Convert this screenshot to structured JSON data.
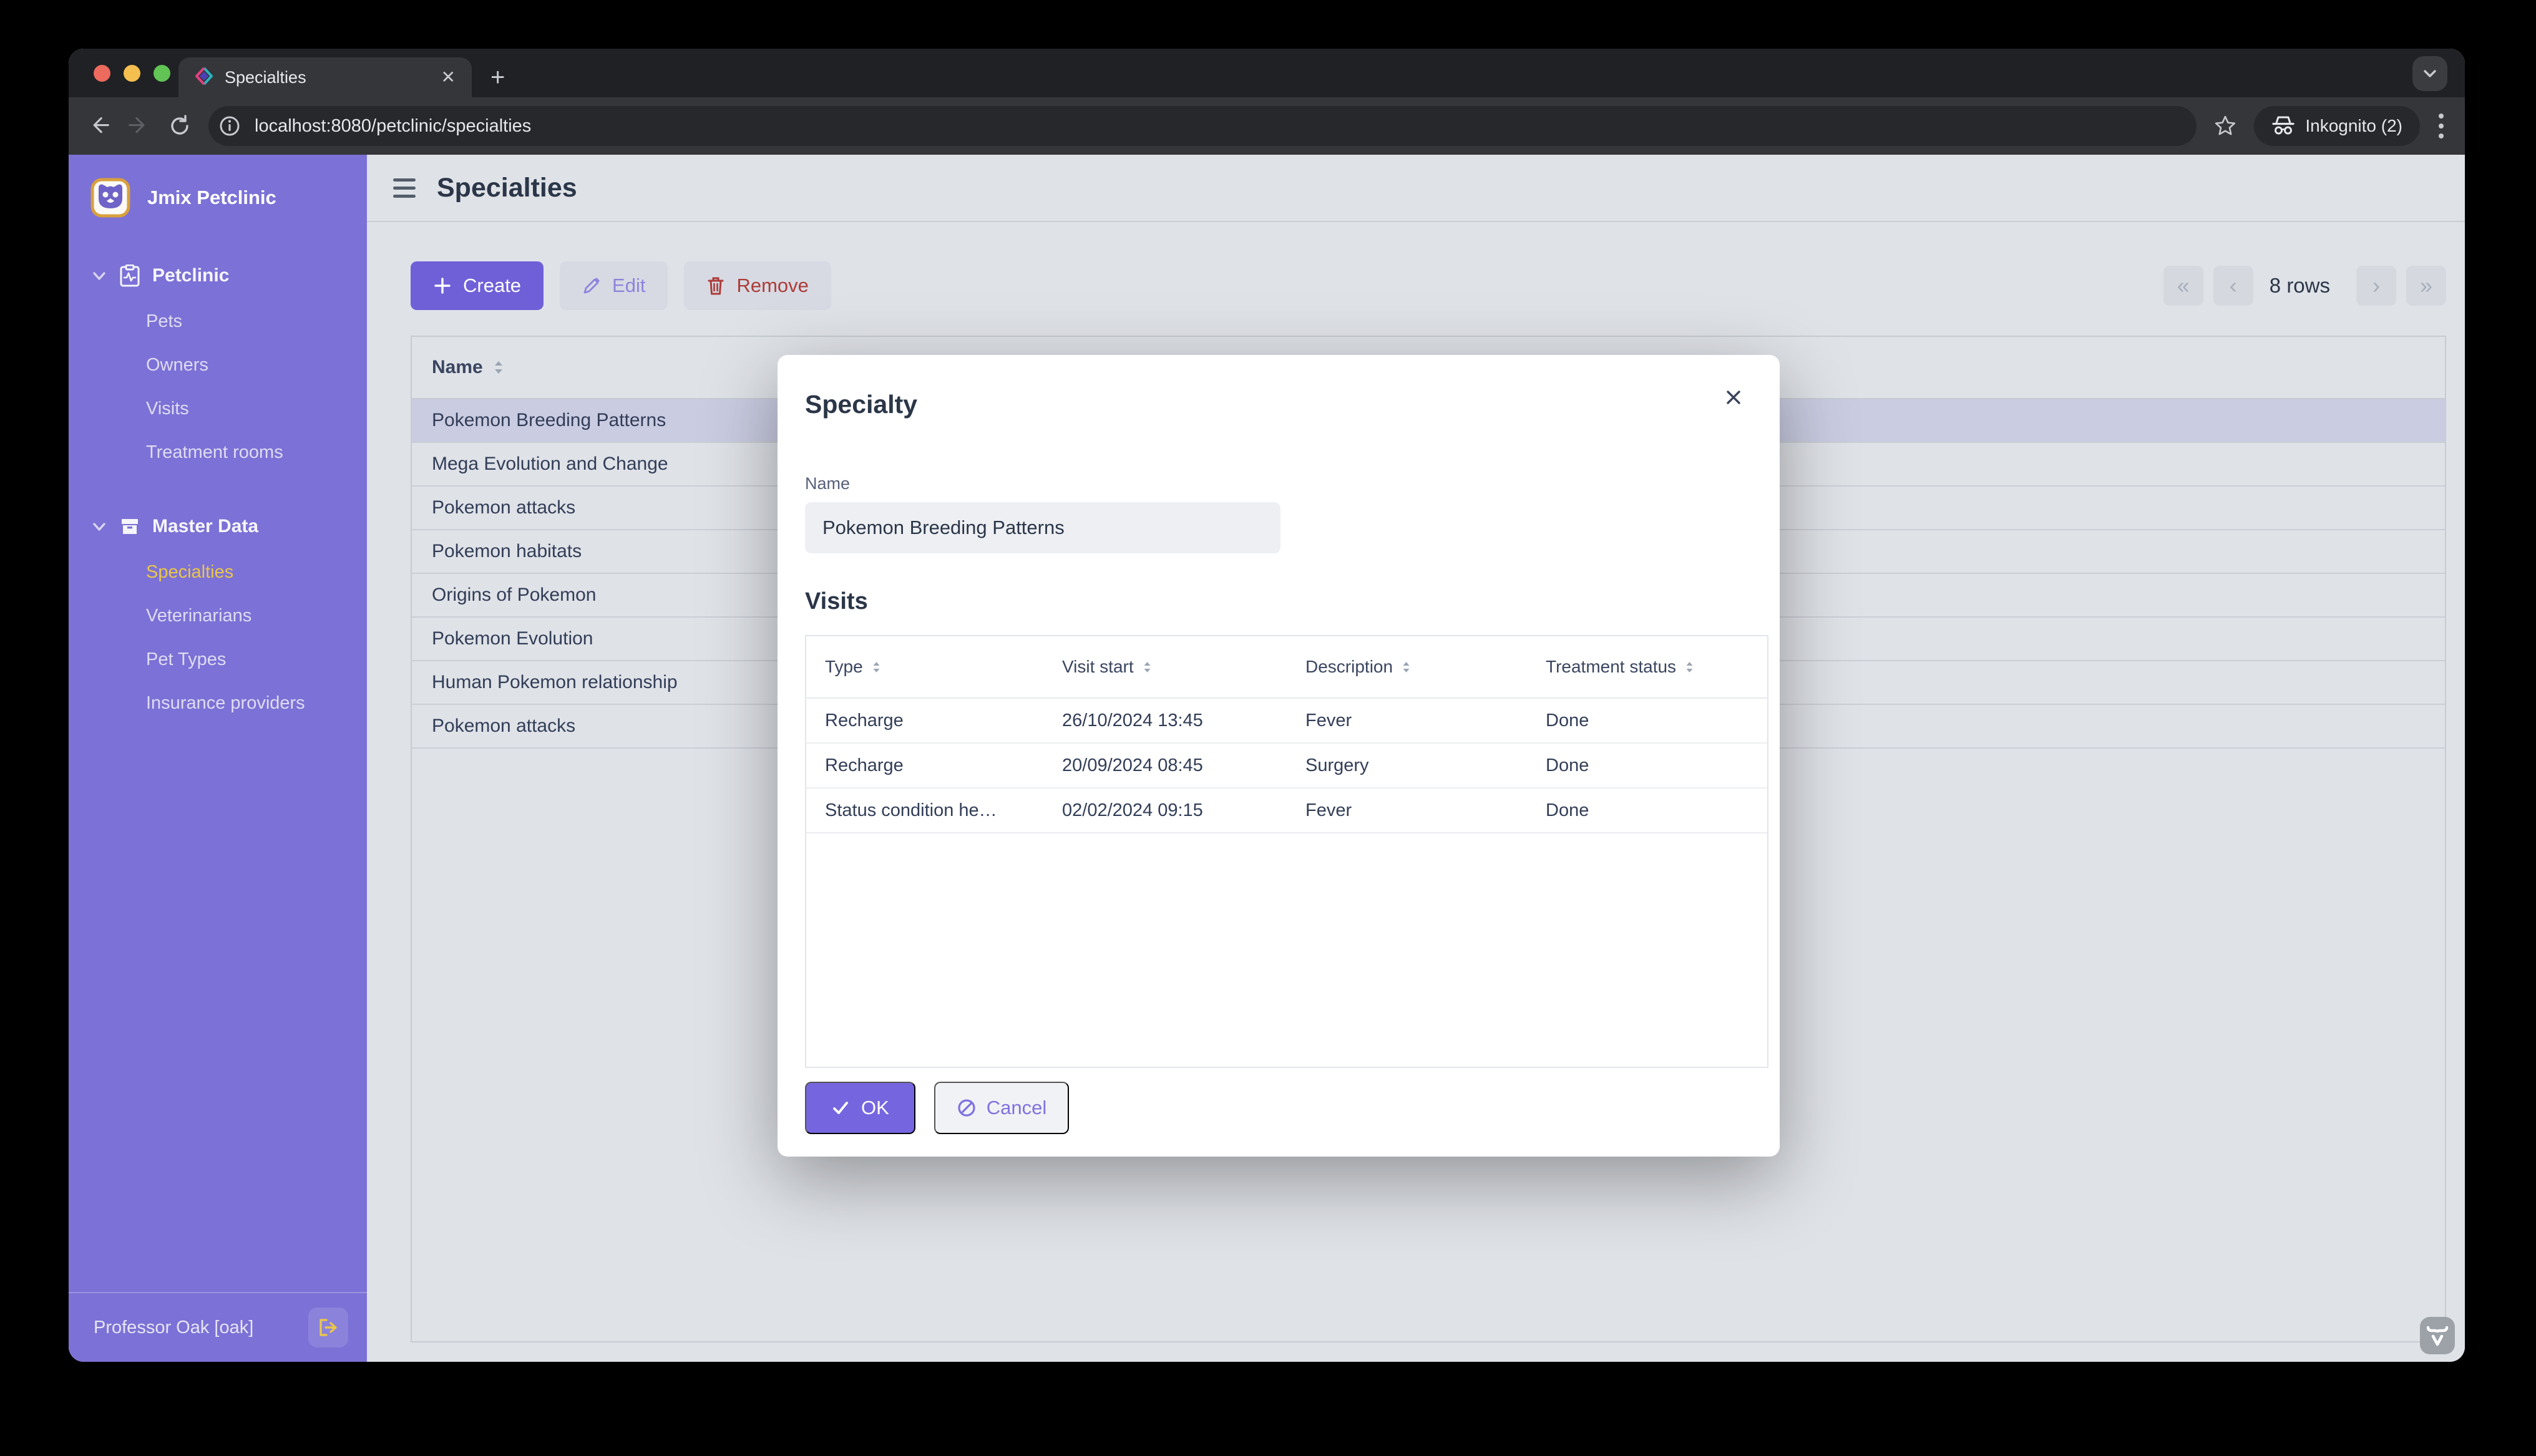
{
  "browser": {
    "tab_title": "Specialties",
    "new_tab_glyph": "+",
    "close_glyph": "✕",
    "url": "localhost:8080/petclinic/specialties",
    "incognito_label": "Inkognito (2)"
  },
  "sidebar": {
    "brand": "Jmix Petclinic",
    "sections": [
      {
        "label": "Petclinic",
        "items": [
          "Pets",
          "Owners",
          "Visits",
          "Treatment rooms"
        ]
      },
      {
        "label": "Master Data",
        "items": [
          "Specialties",
          "Veterinarians",
          "Pet Types",
          "Insurance providers"
        ]
      }
    ],
    "selected_item": "Specialties",
    "user": "Professor Oak [oak]"
  },
  "header": {
    "title": "Specialties"
  },
  "toolbar": {
    "create_label": "Create",
    "edit_label": "Edit",
    "remove_label": "Remove",
    "rows_label": "8 rows",
    "pager_glyphs": {
      "first": "«",
      "prev": "‹",
      "next": "›",
      "last": "»"
    }
  },
  "table": {
    "column": "Name",
    "selected_index": 0,
    "rows": [
      "Pokemon Breeding Patterns",
      "Mega Evolution and Change",
      "Pokemon attacks",
      "Pokemon habitats",
      "Origins of Pokemon",
      "Pokemon Evolution",
      "Human Pokemon relationship",
      "Pokemon attacks"
    ]
  },
  "dialog": {
    "title": "Specialty",
    "close_glyph": "✕",
    "name_label": "Name",
    "name_value": "Pokemon Breeding Patterns",
    "visits_title": "Visits",
    "visits_columns": [
      "Type",
      "Visit start",
      "Description",
      "Treatment status"
    ],
    "visits_rows": [
      [
        "Recharge",
        "26/10/2024 13:45",
        "Fever",
        "Done"
      ],
      [
        "Recharge",
        "20/09/2024 08:45",
        "Surgery",
        "Done"
      ],
      [
        "Status condition he…",
        "02/02/2024 09:15",
        "Fever",
        "Done"
      ]
    ],
    "ok_label": "OK",
    "cancel_label": "Cancel"
  },
  "colors": {
    "sidebar": "#7B71D6",
    "accent_purple": "#6F60D8",
    "selected_gold": "#E9C64B",
    "danger_red": "#AC3C38",
    "selected_row": "#CACCE2",
    "page_bg": "#DFE2E7"
  }
}
